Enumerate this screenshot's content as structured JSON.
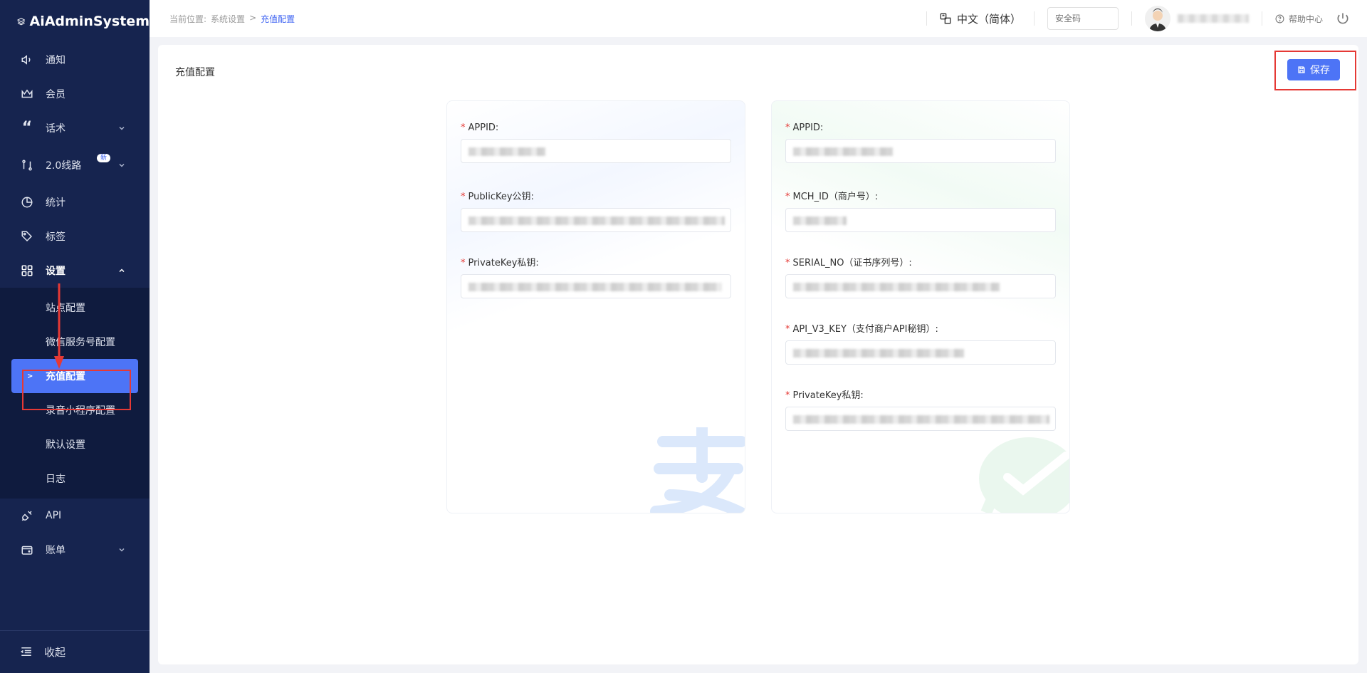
{
  "app": {
    "title": "AiAdminSystem"
  },
  "sidebar": {
    "items": [
      {
        "label": "通知",
        "icon": "speaker-icon"
      },
      {
        "label": "会员",
        "icon": "crown-icon"
      },
      {
        "label": "话术",
        "icon": "quote-icon"
      },
      {
        "label": "2.0线路",
        "icon": "route-icon",
        "badge": "新"
      },
      {
        "label": "统计",
        "icon": "pie-chart-icon"
      },
      {
        "label": "标签",
        "icon": "tag-icon"
      },
      {
        "label": "设置",
        "icon": "grid-icon"
      },
      {
        "label": "API",
        "icon": "plug-icon"
      },
      {
        "label": "账单",
        "icon": "wallet-icon"
      }
    ],
    "settings_sub": [
      "站点配置",
      "微信服务号配置",
      "充值配置",
      "录音小程序配置",
      "默认设置",
      "日志"
    ],
    "collapse_label": "收起"
  },
  "topbar": {
    "breadcrumb_prefix": "当前位置:",
    "breadcrumb_parent": "系统设置",
    "breadcrumb_sep": ">",
    "breadcrumb_current": "充值配置",
    "language": "中文（简体）",
    "security_placeholder": "安全码",
    "help": "帮助中心"
  },
  "page": {
    "title": "充值配置",
    "save_label": "保存"
  },
  "alipay": {
    "appid_label": "APPID:",
    "public_key_label": "PublicKey公钥:",
    "private_key_label": "PrivateKey私钥:"
  },
  "wechat": {
    "appid_label": "APPID:",
    "mch_id_label": "MCH_ID（商户号）:",
    "serial_no_label": "SERIAL_NO（证书序列号）:",
    "api_v3_key_label": "API_V3_KEY（支付商户API秘钥）:",
    "private_key_label": "PrivateKey私钥:"
  },
  "colors": {
    "sidebar_bg": "#16244f",
    "accent": "#4d74f6",
    "highlight": "#e53935",
    "required": "#e53935"
  }
}
